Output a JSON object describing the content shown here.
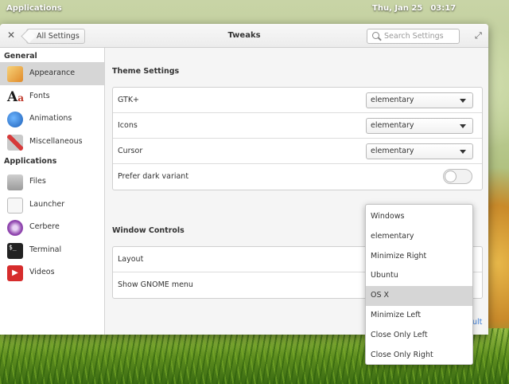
{
  "panel": {
    "applications": "Applications",
    "date": "Thu, Jan 25",
    "time": "03:17"
  },
  "window": {
    "back_label": "All Settings",
    "title": "Tweaks",
    "search_placeholder": "Search Settings"
  },
  "sidebar": {
    "general_header": "General",
    "general_items": [
      {
        "label": "Appearance",
        "icon": "paintbrush-icon",
        "color": "#e8a53c"
      },
      {
        "label": "Fonts",
        "icon": "fonts-icon",
        "color": "#c0392b"
      },
      {
        "label": "Animations",
        "icon": "animation-arrow-icon",
        "color": "#2e86de"
      },
      {
        "label": "Miscellaneous",
        "icon": "tools-icon",
        "color": "#d35454"
      }
    ],
    "applications_header": "Applications",
    "application_items": [
      {
        "label": "Files",
        "icon": "folder-home-icon",
        "color": "#9e9e9e"
      },
      {
        "label": "Launcher",
        "icon": "blank-page-icon",
        "color": "#e0e0e0"
      },
      {
        "label": "Cerbere",
        "icon": "cerbere-icon",
        "color": "#8e44ad"
      },
      {
        "label": "Terminal",
        "icon": "terminal-icon",
        "color": "#222222"
      },
      {
        "label": "Videos",
        "icon": "video-play-icon",
        "color": "#d62c2c"
      }
    ]
  },
  "theme_settings": {
    "title": "Theme Settings",
    "gtk_label": "GTK+",
    "gtk_value": "elementary",
    "icons_label": "Icons",
    "icons_value": "elementary",
    "cursor_label": "Cursor",
    "cursor_value": "elementary",
    "dark_label": "Prefer dark variant",
    "dark_enabled": false
  },
  "window_controls": {
    "title": "Window Controls",
    "layout_label": "Layout",
    "gnome_menu_label": "Show GNOME menu",
    "default_link": "ult"
  },
  "layout_menu": {
    "options": [
      "Windows",
      "elementary",
      "Minimize Right",
      "Ubuntu",
      "OS X",
      "Minimize Left",
      "Close Only Left",
      "Close Only Right"
    ],
    "selected": "OS X"
  }
}
